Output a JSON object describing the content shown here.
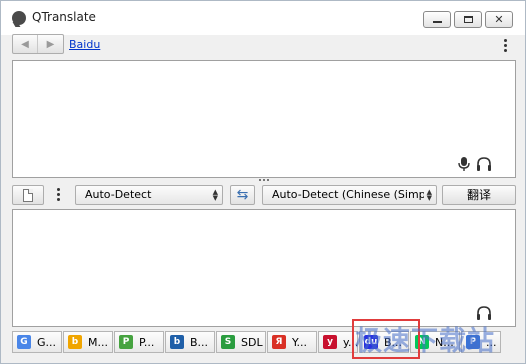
{
  "window": {
    "title": "QTranslate"
  },
  "titlebar": {
    "minimize_icon": "minimize-icon",
    "maximize_icon": "maximize-icon",
    "close_icon": "close-icon"
  },
  "toolbar": {
    "back_glyph": "◀",
    "forward_glyph": "▶",
    "provider": "Baidu"
  },
  "source": {
    "text": ""
  },
  "controls": {
    "source_language": "Auto-Detect",
    "target_language": "Auto-Detect (Chinese (Simp...",
    "translate_label": "翻译",
    "swap_glyph": "⇆"
  },
  "result": {
    "text": ""
  },
  "services": [
    {
      "label": "G...",
      "icon": "google-icon",
      "color": "#4a86e8",
      "glyph": "G"
    },
    {
      "label": "M...",
      "icon": "bing-icon",
      "color": "#f0a500",
      "glyph": "b"
    },
    {
      "label": "P...",
      "icon": "promt-icon",
      "color": "#46a340",
      "glyph": "P"
    },
    {
      "label": "B...",
      "icon": "babylon-icon",
      "color": "#1f5fa8",
      "glyph": "b"
    },
    {
      "label": "SDL",
      "icon": "sdl-icon",
      "color": "#2a9d3f",
      "glyph": "S"
    },
    {
      "label": "Y...",
      "icon": "yandex-icon",
      "color": "#d93025",
      "glyph": "Я"
    },
    {
      "label": "y...",
      "icon": "youdao-icon",
      "color": "#c8102e",
      "glyph": "y"
    },
    {
      "label": "B...",
      "icon": "baidu-icon",
      "color": "#2932e1",
      "glyph": "du"
    },
    {
      "label": "N...",
      "icon": "naver-icon",
      "color": "#03c75a",
      "glyph": "N"
    },
    {
      "label": "...",
      "icon": "other-service-icon",
      "color": "#3b73d6",
      "glyph": "P"
    }
  ],
  "watermark": {
    "text": "极速下载站"
  }
}
